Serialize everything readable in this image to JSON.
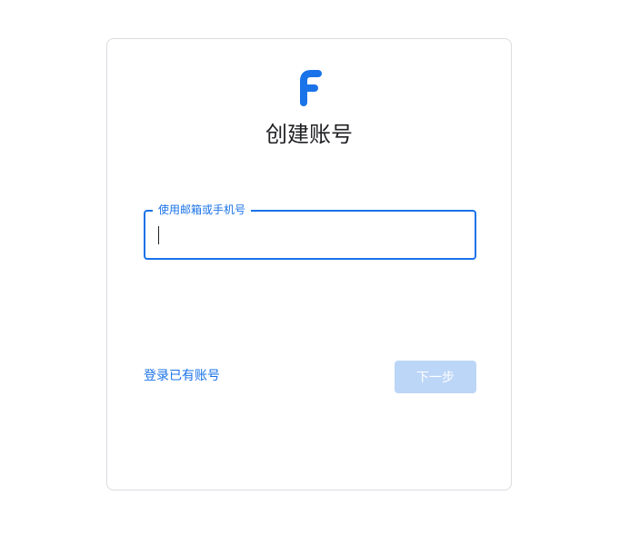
{
  "brand": {
    "logo_icon": "letter-f-logo-icon",
    "accent_color": "#1a73e8"
  },
  "page": {
    "title": "创建账号"
  },
  "form": {
    "email_label": "使用邮箱或手机号",
    "email_value": "",
    "signin_link": "登录已有账号",
    "next_button": "下一步",
    "next_button_color": "#bcd6f7"
  }
}
